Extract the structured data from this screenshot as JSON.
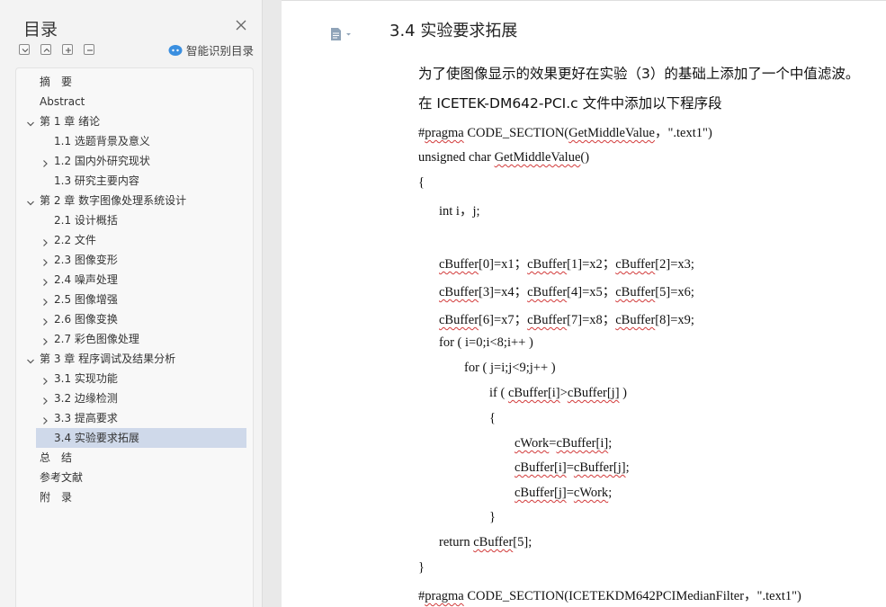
{
  "toc": {
    "title": "目录",
    "smart_toc_label": "智能识别目录",
    "items": [
      {
        "label": "摘　要",
        "level": 1,
        "caret": "none",
        "selected": false
      },
      {
        "label": "Abstract",
        "level": 1,
        "caret": "none",
        "selected": false
      },
      {
        "label": "第 1 章  绪论",
        "level": 1,
        "caret": "down",
        "selected": false
      },
      {
        "label": "1.1 选题背景及意义",
        "level": 2,
        "caret": "none",
        "selected": false
      },
      {
        "label": "1.2 国内外研究现状",
        "level": 2,
        "caret": "right",
        "selected": false
      },
      {
        "label": "1.3 研究主要内容",
        "level": 2,
        "caret": "none",
        "selected": false
      },
      {
        "label": "第 2 章  数字图像处理系统设计",
        "level": 1,
        "caret": "down",
        "selected": false
      },
      {
        "label": "2.1 设计概括",
        "level": 2,
        "caret": "none",
        "selected": false
      },
      {
        "label": "2.2 文件",
        "level": 2,
        "caret": "right",
        "selected": false
      },
      {
        "label": "2.3 图像变形",
        "level": 2,
        "caret": "right",
        "selected": false
      },
      {
        "label": "2.4 噪声处理",
        "level": 2,
        "caret": "right",
        "selected": false
      },
      {
        "label": "2.5 图像增强",
        "level": 2,
        "caret": "right",
        "selected": false
      },
      {
        "label": "2.6 图像变换",
        "level": 2,
        "caret": "right",
        "selected": false
      },
      {
        "label": "2.7 彩色图像处理",
        "level": 2,
        "caret": "right",
        "selected": false
      },
      {
        "label": "第 3 章  程序调试及结果分析",
        "level": 1,
        "caret": "down",
        "selected": false
      },
      {
        "label": "3.1 实现功能",
        "level": 2,
        "caret": "right",
        "selected": false
      },
      {
        "label": "3.2 边缘检测",
        "level": 2,
        "caret": "right",
        "selected": false
      },
      {
        "label": "3.3 提高要求",
        "level": 2,
        "caret": "right",
        "selected": false
      },
      {
        "label": "3.4 实验要求拓展",
        "level": 2,
        "caret": "none",
        "selected": true
      },
      {
        "label": "总　结",
        "level": 1,
        "caret": "none",
        "selected": false
      },
      {
        "label": "参考文献",
        "level": 1,
        "caret": "none",
        "selected": false
      },
      {
        "label": "附　录",
        "level": 1,
        "caret": "none",
        "selected": false
      }
    ]
  },
  "document": {
    "heading": "3.4 实验要求拓展",
    "lines": [
      {
        "segs": [
          {
            "t": "为了使图像显示的效果更好在实验（3）的基础上添加了一个中值滤波。",
            "w": false
          }
        ],
        "cn": true
      },
      {
        "segs": [
          {
            "t": "在 ICETEK-DM642-PCI.c 文件中添加以下程序段",
            "w": false
          }
        ],
        "cn": true
      },
      {
        "segs": [
          {
            "t": "#",
            "w": false
          },
          {
            "t": "pragma",
            "w": true
          },
          {
            "t": " CODE_SECTION(",
            "w": false
          },
          {
            "t": "GetMiddleValue",
            "w": true
          },
          {
            "t": "，\".text1\")",
            "w": false
          }
        ]
      },
      {
        "segs": [
          {
            "t": "unsigned char ",
            "w": false
          },
          {
            "t": "GetMiddleValue",
            "w": true
          },
          {
            "t": "()",
            "w": false
          }
        ]
      },
      {
        "segs": [
          {
            "t": "{",
            "w": false
          }
        ]
      },
      {
        "segs": [
          {
            "t": "int i，j;",
            "w": false
          }
        ]
      },
      {
        "segs": [
          {
            "t": "cBuffer",
            "w": true
          },
          {
            "t": "[0]=x1；",
            "w": false
          },
          {
            "t": "cBuffer",
            "w": true
          },
          {
            "t": "[1]=x2；",
            "w": false
          },
          {
            "t": "cBuffer",
            "w": true
          },
          {
            "t": "[2]=x3;",
            "w": false
          }
        ]
      },
      {
        "segs": [
          {
            "t": "cBuffer",
            "w": true
          },
          {
            "t": "[3]=x4；",
            "w": false
          },
          {
            "t": "cBuffer",
            "w": true
          },
          {
            "t": "[4]=x5；",
            "w": false
          },
          {
            "t": "cBuffer",
            "w": true
          },
          {
            "t": "[5]=x6;",
            "w": false
          }
        ]
      },
      {
        "segs": [
          {
            "t": "cBuffer",
            "w": true
          },
          {
            "t": "[6]=x7；",
            "w": false
          },
          {
            "t": "cBuffer",
            "w": true
          },
          {
            "t": "[7]=x8；",
            "w": false
          },
          {
            "t": "cBuffer",
            "w": true
          },
          {
            "t": "[8]=x9;",
            "w": false
          }
        ]
      },
      {
        "segs": [
          {
            "t": "for ( i=0;i<8;i++ )",
            "w": false
          }
        ]
      },
      {
        "segs": [
          {
            "t": "for ( j=i;j<9;j++ )",
            "w": false
          }
        ]
      },
      {
        "segs": [
          {
            "t": "if ( ",
            "w": false
          },
          {
            "t": "cBuffer[i]",
            "w": true
          },
          {
            "t": ">",
            "w": false
          },
          {
            "t": "cBuffer[j]",
            "w": true
          },
          {
            "t": " )",
            "w": false
          }
        ]
      },
      {
        "segs": [
          {
            "t": "{",
            "w": false
          }
        ]
      },
      {
        "segs": [
          {
            "t": "cWork",
            "w": true
          },
          {
            "t": "=",
            "w": false
          },
          {
            "t": "cBuffer[i]",
            "w": true
          },
          {
            "t": ";",
            "w": false
          }
        ]
      },
      {
        "segs": [
          {
            "t": "cBuffer[i]",
            "w": true
          },
          {
            "t": "=",
            "w": false
          },
          {
            "t": "cBuffer[j]",
            "w": true
          },
          {
            "t": ";",
            "w": false
          }
        ]
      },
      {
        "segs": [
          {
            "t": "cBuffer[j]",
            "w": true
          },
          {
            "t": "=",
            "w": false
          },
          {
            "t": "cWork",
            "w": true
          },
          {
            "t": ";",
            "w": false
          }
        ]
      },
      {
        "segs": [
          {
            "t": "}",
            "w": false
          }
        ]
      },
      {
        "segs": [
          {
            "t": "return ",
            "w": false
          },
          {
            "t": "cBuffer",
            "w": true
          },
          {
            "t": "[5];",
            "w": false
          }
        ]
      },
      {
        "segs": [
          {
            "t": "}",
            "w": false
          }
        ]
      },
      {
        "segs": [
          {
            "t": "#",
            "w": false
          },
          {
            "t": "pragma",
            "w": true
          },
          {
            "t": " CODE_SECTION(ICETEKDM642PCIMedianFilter，\".text1\")",
            "w": false
          }
        ]
      }
    ]
  },
  "colors": {
    "accent_selected": "#cfd9ea",
    "spell_underline": "#d23b3b",
    "ai_icon": "#3a8fe0"
  }
}
